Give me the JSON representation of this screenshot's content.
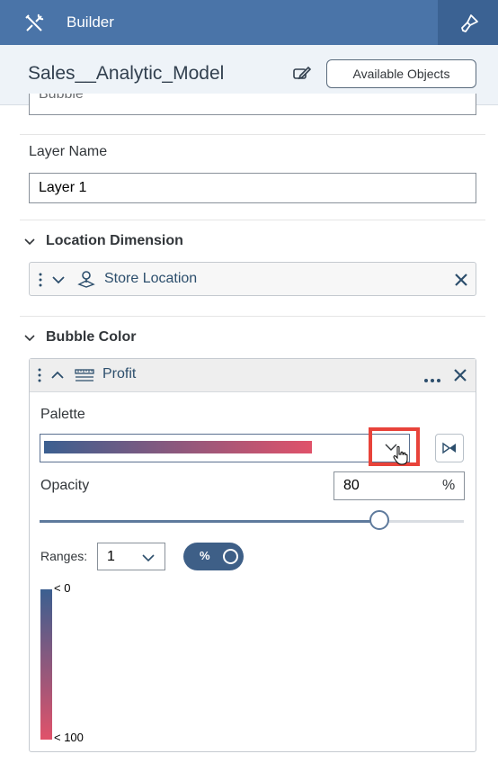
{
  "header": {
    "title": "Builder",
    "tools_icon": "wrench-screwdriver-icon",
    "designer_icon": "paintbrush-icon"
  },
  "model": {
    "name": "Sales__Analytic_Model",
    "edit_icon": "edit-model-icon",
    "available_objects_label": "Available Objects"
  },
  "layer_type": {
    "value": "Bubble"
  },
  "layer_name": {
    "label": "Layer Name",
    "value": "Layer 1"
  },
  "location_dimension": {
    "title": "Location Dimension",
    "item": {
      "label": "Store Location",
      "icon": "location-pin-icon"
    }
  },
  "bubble_color": {
    "title": "Bubble Color",
    "measure": {
      "label": "Profit",
      "icon": "measure-icon"
    },
    "palette": {
      "label": "Palette",
      "start_color": "#3b5f90",
      "end_color": "#e0526a"
    },
    "opacity": {
      "label": "Opacity",
      "value": "80",
      "unit": "%",
      "slider_level": 0.8
    },
    "ranges": {
      "label": "Ranges:",
      "value": "1",
      "toggle_label": "%"
    },
    "legend": {
      "top_label": "< 0",
      "bottom_label": "< 100"
    }
  },
  "colors": {
    "header_bar": "#4a74a8",
    "header_bar_dark": "#3b6293",
    "highlight": "#e8433a",
    "accent": "#3b5f90"
  }
}
